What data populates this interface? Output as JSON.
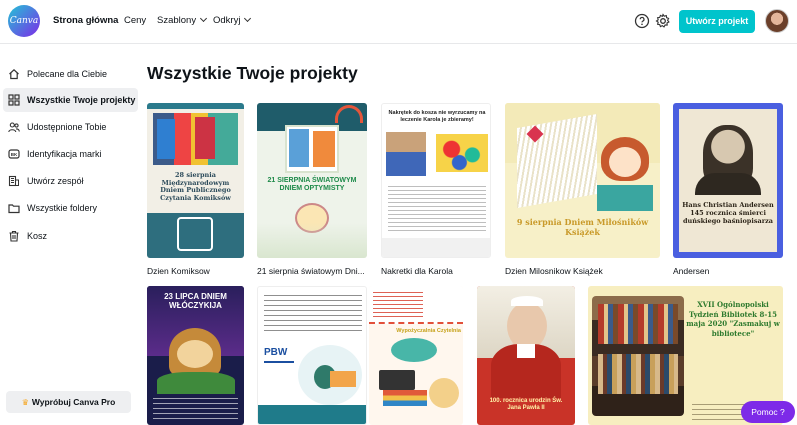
{
  "header": {
    "logo_text": "Canva",
    "nav": [
      {
        "label": "Strona główna"
      },
      {
        "label": "Ceny"
      },
      {
        "label": "Szablony"
      },
      {
        "label": "Odkryj"
      }
    ],
    "create_button": "Utwórz projekt"
  },
  "sidebar": {
    "items": [
      {
        "label": "Polecane dla Ciebie",
        "icon": "home-icon"
      },
      {
        "label": "Wszystkie Twoje projekty",
        "icon": "grid-icon"
      },
      {
        "label": "Udostępnione Tobie",
        "icon": "people-icon"
      },
      {
        "label": "Identyfikacja marki",
        "icon": "brand-icon"
      },
      {
        "label": "Utwórz zespół",
        "icon": "building-icon"
      },
      {
        "label": "Wszystkie foldery",
        "icon": "folder-icon"
      },
      {
        "label": "Kosz",
        "icon": "trash-icon"
      }
    ],
    "try_pro": "Wypróbuj Canva Pro"
  },
  "main": {
    "title": "Wszystkie Twoje projekty",
    "projects": [
      {
        "name": "Dzien Komiksow",
        "thumb_text": "28 sierpnia Międzynarodowym Dniem Publicznego Czytania Komiksów"
      },
      {
        "name": "21 sierpnia światowym Dni...",
        "thumb_text": "21 SIERPNIA ŚWIATOWYM DNIEM OPTYMISTY"
      },
      {
        "name": "Nakretki dla Karola",
        "thumb_text": "Nakrętek do kosza nie wyrzucamy na leczenie Karola je zbieramy!"
      },
      {
        "name": "Dzien Milosnikow Książek",
        "thumb_text": "9 sierpnia Dniem Miłośników Książek"
      },
      {
        "name": "Andersen",
        "thumb_text": "Hans Christian Andersen 145 rocznica śmierci duńskiego baśniopisarza"
      },
      {
        "name": "",
        "thumb_text": "23 LIPCA DNIEM WŁÓCZYKIJA"
      },
      {
        "name": "",
        "thumb_text": "PBW"
      },
      {
        "name": "",
        "thumb_text": "Wypożyczalnia Czytelnia"
      },
      {
        "name": "",
        "thumb_text": "100. rocznica urodzin Św. Jana Pawła II"
      },
      {
        "name": "",
        "thumb_text": "XVII Ogólnopolski Tydzień Bibliotek 8-15 maja 2020 \"Zasmakuj w bibliotece\""
      }
    ]
  },
  "help_button": "Pomoc ?"
}
